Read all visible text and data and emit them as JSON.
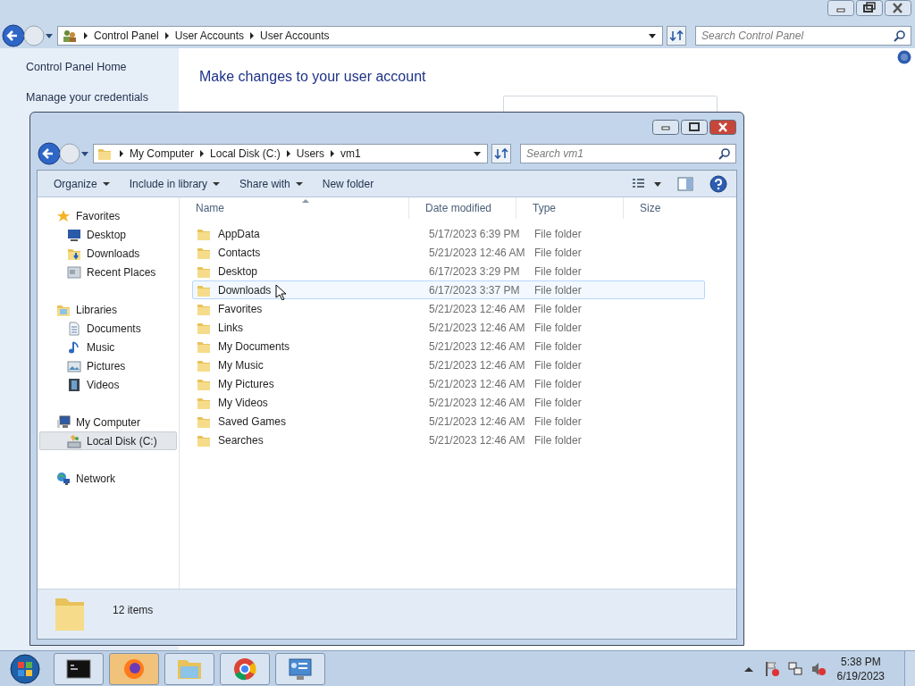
{
  "background_window": {
    "breadcrumb": [
      "Control Panel",
      "User Accounts",
      "User Accounts"
    ],
    "search": {
      "placeholder": "Search Control Panel"
    },
    "sidebar": {
      "items": [
        "Control Panel Home",
        "Manage your credentials"
      ]
    },
    "heading": "Make changes to your user account"
  },
  "explorer": {
    "breadcrumb": [
      "My Computer",
      "Local Disk (C:)",
      "Users",
      "vm1"
    ],
    "search": {
      "placeholder": "Search vm1"
    },
    "toolbar": [
      {
        "label": "Organize",
        "dropdown": true
      },
      {
        "label": "Include in library",
        "dropdown": true
      },
      {
        "label": "Share with",
        "dropdown": true
      },
      {
        "label": "New folder",
        "dropdown": false
      }
    ],
    "nav": [
      {
        "label": "Favorites",
        "kind": "star",
        "selected": false,
        "children": [
          {
            "label": "Desktop",
            "kind": "desktop",
            "selected": false
          },
          {
            "label": "Downloads",
            "kind": "downloads",
            "selected": false
          },
          {
            "label": "Recent Places",
            "kind": "recent",
            "selected": false
          }
        ]
      },
      {
        "label": "Libraries",
        "kind": "libraries",
        "selected": false,
        "children": [
          {
            "label": "Documents",
            "kind": "document",
            "selected": false
          },
          {
            "label": "Music",
            "kind": "music",
            "selected": false
          },
          {
            "label": "Pictures",
            "kind": "pictures",
            "selected": false
          },
          {
            "label": "Videos",
            "kind": "videos",
            "selected": false
          }
        ]
      },
      {
        "label": "My Computer",
        "kind": "computer",
        "selected": false,
        "children": [
          {
            "label": "Local Disk (C:)",
            "kind": "disk",
            "selected": true
          }
        ]
      },
      {
        "label": "Network",
        "kind": "network",
        "selected": false
      }
    ],
    "columns": [
      "Name",
      "Date modified",
      "Type",
      "Size"
    ],
    "rows": [
      {
        "name": "AppData",
        "date": "5/17/2023 6:39 PM",
        "type": "File folder",
        "hovered": false
      },
      {
        "name": "Contacts",
        "date": "5/21/2023 12:46 AM",
        "type": "File folder",
        "hovered": false
      },
      {
        "name": "Desktop",
        "date": "6/17/2023 3:29 PM",
        "type": "File folder",
        "hovered": false
      },
      {
        "name": "Downloads",
        "date": "6/17/2023 3:37 PM",
        "type": "File folder",
        "hovered": true
      },
      {
        "name": "Favorites",
        "date": "5/21/2023 12:46 AM",
        "type": "File folder",
        "hovered": false
      },
      {
        "name": "Links",
        "date": "5/21/2023 12:46 AM",
        "type": "File folder",
        "hovered": false
      },
      {
        "name": "My Documents",
        "date": "5/21/2023 12:46 AM",
        "type": "File folder",
        "hovered": false
      },
      {
        "name": "My Music",
        "date": "5/21/2023 12:46 AM",
        "type": "File folder",
        "hovered": false
      },
      {
        "name": "My Pictures",
        "date": "5/21/2023 12:46 AM",
        "type": "File folder",
        "hovered": false
      },
      {
        "name": "My Videos",
        "date": "5/21/2023 12:46 AM",
        "type": "File folder",
        "hovered": false
      },
      {
        "name": "Saved Games",
        "date": "5/21/2023 12:46 AM",
        "type": "File folder",
        "hovered": false
      },
      {
        "name": "Searches",
        "date": "5/21/2023 12:46 AM",
        "type": "File folder",
        "hovered": false
      }
    ],
    "status": "12 items"
  },
  "taskbar": {
    "apps": [
      {
        "kind": "terminal"
      },
      {
        "kind": "firefox"
      },
      {
        "kind": "explorer"
      },
      {
        "kind": "chrome"
      },
      {
        "kind": "controlpanel"
      }
    ],
    "time": "5:38 PM",
    "date": "6/19/2023"
  }
}
